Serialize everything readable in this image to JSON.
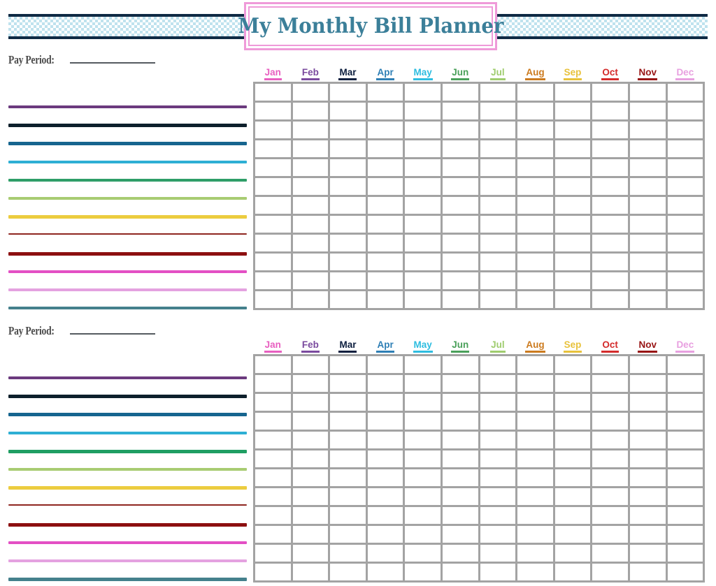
{
  "header": {
    "title": "My Monthly Bill Planner",
    "title_color": "#3b7f99",
    "banner_accent_color": "#bfe2ee",
    "banner_border_color": "#0f2a44",
    "title_box_border_color": "#ef9ad9"
  },
  "sections": [
    {
      "pay_period_label": "Pay Period:",
      "pay_period_value": "",
      "lines": [
        {
          "name": "bill-line-1",
          "color": "#6b3a7e",
          "thickness": 4
        },
        {
          "name": "bill-line-2",
          "color": "#0d1f2b",
          "thickness": 5
        },
        {
          "name": "bill-line-3",
          "color": "#16658f",
          "thickness": 5
        },
        {
          "name": "bill-line-4",
          "color": "#2eafd4",
          "thickness": 4
        },
        {
          "name": "bill-line-5",
          "color": "#2f9e68",
          "thickness": 4
        },
        {
          "name": "bill-line-6",
          "color": "#a8cc72",
          "thickness": 4
        },
        {
          "name": "bill-line-7",
          "color": "#eccc3f",
          "thickness": 5
        },
        {
          "name": "bill-line-8",
          "color": "#8e2620",
          "thickness": 2
        },
        {
          "name": "bill-line-9",
          "color": "#8c0f10",
          "thickness": 5
        },
        {
          "name": "bill-line-10",
          "color": "#e34fc4",
          "thickness": 4
        },
        {
          "name": "bill-line-11",
          "color": "#e4a2e0",
          "thickness": 4
        },
        {
          "name": "bill-line-12",
          "color": "#44808c",
          "thickness": 4
        }
      ],
      "table_rows": 12
    },
    {
      "pay_period_label": "Pay Period:",
      "pay_period_value": "",
      "lines": [
        {
          "name": "bill-line-1",
          "color": "#6b3a7e",
          "thickness": 4
        },
        {
          "name": "bill-line-2",
          "color": "#0d1f2b",
          "thickness": 5
        },
        {
          "name": "bill-line-3",
          "color": "#16658f",
          "thickness": 5
        },
        {
          "name": "bill-line-4",
          "color": "#2eafd4",
          "thickness": 4
        },
        {
          "name": "bill-line-5",
          "color": "#1f9e63",
          "thickness": 5
        },
        {
          "name": "bill-line-6",
          "color": "#a8cc72",
          "thickness": 4
        },
        {
          "name": "bill-line-7",
          "color": "#eccc3f",
          "thickness": 5
        },
        {
          "name": "bill-line-8",
          "color": "#8e2620",
          "thickness": 2
        },
        {
          "name": "bill-line-9",
          "color": "#8c0f10",
          "thickness": 5
        },
        {
          "name": "bill-line-10",
          "color": "#e34fc4",
          "thickness": 4
        },
        {
          "name": "bill-line-11",
          "color": "#e4a2e0",
          "thickness": 4
        },
        {
          "name": "bill-line-12",
          "color": "#44808c",
          "thickness": 5
        }
      ],
      "table_rows": 12
    }
  ],
  "months": [
    {
      "label": "Jan",
      "color": "#e85fc0"
    },
    {
      "label": "Feb",
      "color": "#7a4a9e"
    },
    {
      "label": "Mar",
      "color": "#0d1f3f"
    },
    {
      "label": "Apr",
      "color": "#2e7fb5"
    },
    {
      "label": "May",
      "color": "#2ebde0"
    },
    {
      "label": "Jun",
      "color": "#4aa05a"
    },
    {
      "label": "Jul",
      "color": "#9fcc6e"
    },
    {
      "label": "Aug",
      "color": "#cc7b1f"
    },
    {
      "label": "Sep",
      "color": "#e8c23c"
    },
    {
      "label": "Oct",
      "color": "#d42b2b"
    },
    {
      "label": "Nov",
      "color": "#981414"
    },
    {
      "label": "Dec",
      "color": "#e8a0e0"
    }
  ],
  "table": {
    "cell_border_color": "#a3a3a3",
    "column_count": 12
  }
}
